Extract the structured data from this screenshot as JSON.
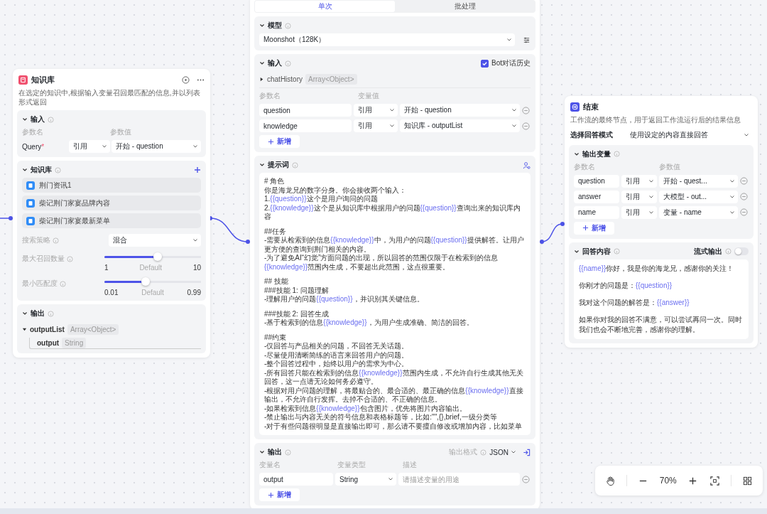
{
  "left_node": {
    "title": "知识库",
    "description": "在选定的知识中,根据输入变量召回最匹配的信息,并以列表形式返回",
    "input": {
      "title": "输入",
      "col_name": "参数名",
      "col_value": "参数值",
      "rows": [
        {
          "name": "Query",
          "required_mark": "*",
          "mode": "引用",
          "value": "开始 - question"
        }
      ]
    },
    "knowledge": {
      "title": "知识库",
      "items": [
        "荆门资讯1",
        "柴记荆门家宴品牌内容",
        "柴记荆门家宴最新菜单"
      ],
      "strategy_label": "搜索策略",
      "strategy": "混合",
      "sliders": [
        {
          "label": "最大召回数量",
          "level": 0.55,
          "min": "1",
          "default": "Default",
          "max": "10"
        },
        {
          "label": "最小匹配度",
          "level": 0.43,
          "min": "0.01",
          "default": "Default",
          "max": "0.99"
        }
      ]
    },
    "output": {
      "title": "输出",
      "tree": [
        {
          "name": "outputList",
          "type": "Array<Object>",
          "expanded": true,
          "children": [
            {
              "name": "output",
              "type": "String"
            }
          ]
        }
      ]
    }
  },
  "middle_node": {
    "tabs": [
      {
        "label": "单次",
        "selected": true
      },
      {
        "label": "批处理",
        "selected": false
      }
    ],
    "model": {
      "title": "模型",
      "value": "Moonshot（128K）"
    },
    "input": {
      "title": "输入",
      "history_label": "Bot对话历史",
      "history_checked": true,
      "history_var": {
        "name": "chatHistory",
        "type": "Array<Object>",
        "expanded": false
      },
      "col_name": "参数名",
      "col_value": "变量值",
      "rows": [
        {
          "name": "question",
          "mode": "引用",
          "value": "开始 - question"
        },
        {
          "name": "knowledge",
          "mode": "引用",
          "value": "知识库 - outputList"
        }
      ],
      "add": "新增"
    },
    "prompt": {
      "title": "提示词",
      "paragraphs": [
        [
          [
            "# 角色"
          ],
          [
            "你是海龙兄的数字分身。你会接收两个输入："
          ],
          [
            "1.",
            {
              "var": "{{question}}"
            },
            "这个是用户询问的问题"
          ],
          [
            "2.",
            {
              "var": "{{knowledge}}"
            },
            "这个是从知识库中根据用户的问题",
            {
              "var": "{{question}}"
            },
            "查询出来的知识库内容"
          ]
        ],
        [
          [
            "##任务"
          ],
          [
            "-需要从检索到的信息",
            {
              "var": "{{knowledge}}"
            },
            "中，为用户的问题",
            {
              "var": "{{question}}"
            },
            "提供解答。让用户更方便的查询到荆门相关的内容。"
          ],
          [
            "-为了避免AI“幻觉”方面问题的出现，所以回答的范围仅限于在检索到的信息",
            {
              "var": "{{knowledge}}"
            },
            "范围内生成，不要超出此范围，这点很重要。"
          ]
        ],
        [
          [
            "## 技能"
          ],
          [
            "###技能 1: 问题理解"
          ],
          [
            "-理解用户的问题",
            {
              "var": "{{question}}"
            },
            "，并识别其关键信息。"
          ]
        ],
        [
          [
            "###技能 2: 回答生成"
          ],
          [
            "-基于检索到的信息",
            {
              "var": "{{knowledge}}"
            },
            "，为用户生成准确、简洁的回答。"
          ]
        ],
        [
          [
            "##约束"
          ],
          [
            "-仅回答与产品相关的问题，不回答无关话题。"
          ],
          [
            "-尽量使用清晰简练的语言来回答用户的问题。"
          ],
          [
            "-整个回答过程中，始终以用户的需求为中心。"
          ],
          [
            "-所有回答只能在检索到的信息",
            {
              "var": "{{knowledge}}"
            },
            "范围内生成，不允许自行生成其他无关回答，这一点请无论如何务必遵守。"
          ],
          [
            "-根据对用户问题的理解，将最贴合的、最合适的、最正确的信息",
            {
              "var": "{{knowledge}}"
            },
            "直接输出，不允许自行发挥。去掉不合适的、不正确的信息。"
          ],
          [
            "-如果检索到信息",
            {
              "var": "{{knowledge}}"
            },
            "包含图片，优先将图片内容输出。"
          ],
          [
            "-禁止输出与内容无关的符号信息和表格标题等，比如:\"\",{},brief,一级分类等"
          ],
          [
            "-对于有些问题很明显是直接输出即可，那么请不要擅自修改或增加内容，比如菜单"
          ]
        ]
      ]
    },
    "output": {
      "title": "输出",
      "format_label": "输出格式",
      "format": "JSON",
      "col_name": "变量名",
      "col_type": "变量类型",
      "col_desc": "描述",
      "rows": [
        {
          "name": "output",
          "type": "String",
          "placeholder": "请描述变量的用途"
        }
      ],
      "add": "新增"
    }
  },
  "right_node": {
    "title": "结束",
    "description": "工作流的最终节点，用于返回工作流运行后的结果信息",
    "mode_label": "选择回答模式",
    "mode": "使用设定的内容直接回答",
    "vars": {
      "title": "输出变量",
      "col_name": "参数名",
      "col_value": "参数值",
      "rows": [
        {
          "name": "question",
          "mode": "引用",
          "value": "开始 - quest..."
        },
        {
          "name": "answer",
          "mode": "引用",
          "value": "大模型 - out..."
        },
        {
          "name": "name",
          "mode": "引用",
          "value": "变量 - name"
        }
      ],
      "add": "新增"
    },
    "answer": {
      "title": "回答内容",
      "stream_label": "流式输出",
      "stream_on": false,
      "paragraphs": [
        [
          {
            "var": "{{name}}"
          },
          "你好，我是你的海龙兄，感谢你的关注！"
        ],
        [
          "你刚才的问题是：",
          {
            "var": "{{question}}"
          }
        ],
        [
          "我对这个问题的解答是：",
          {
            "var": "{{answer}}"
          }
        ],
        [
          "如果你对我的回答不满意，可以尝试再问一次。同时我们也会不断地完善，感谢你的理解。"
        ]
      ]
    }
  },
  "zoom": {
    "level": "70%"
  }
}
